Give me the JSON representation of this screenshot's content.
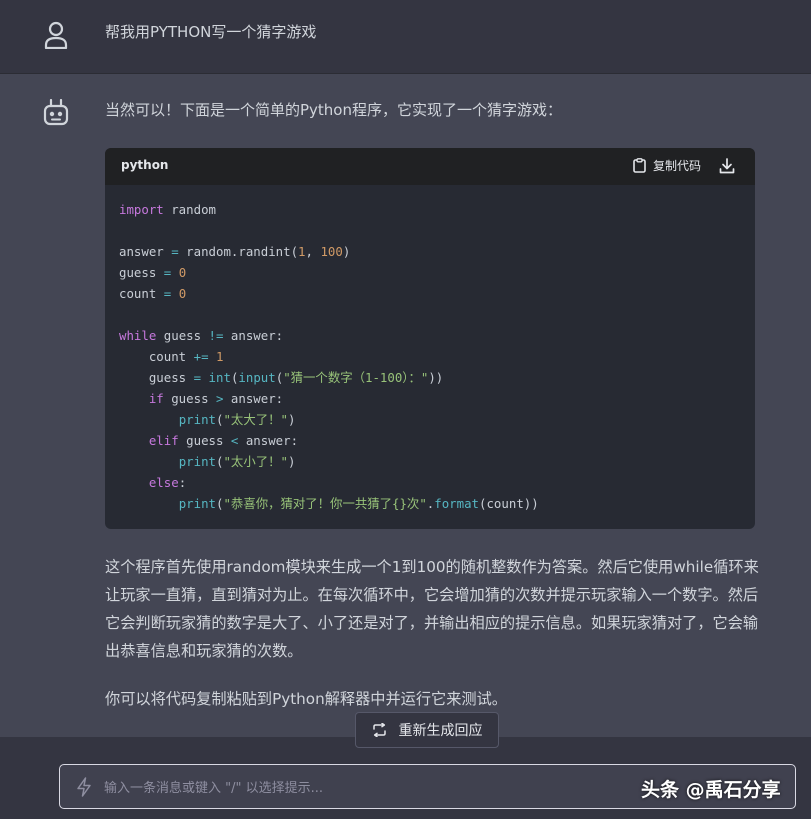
{
  "user_message": {
    "text": "帮我用PYTHON写一个猜字游戏"
  },
  "assistant": {
    "intro": "当然可以！下面是一个简单的Python程序，它实现了一个猜字游戏：",
    "code_block": {
      "language": "python",
      "copy_label": "复制代码",
      "lines": [
        "import random",
        "",
        "answer = random.randint(1, 100)",
        "guess = 0",
        "count = 0",
        "",
        "while guess != answer:",
        "    count += 1",
        "    guess = int(input(\"猜一个数字（1-100）：\"))",
        "    if guess > answer:",
        "        print(\"太大了！\")",
        "    elif guess < answer:",
        "        print(\"太小了！\")",
        "    else:",
        "        print(\"恭喜你，猜对了！你一共猜了{}次\".format(count))"
      ]
    },
    "paragraph_1": "这个程序首先使用random模块来生成一个1到100的随机整数作为答案。然后它使用while循环来让玩家一直猜，直到猜对为止。在每次循环中，它会增加猜的次数并提示玩家输入一个数字。然后它会判断玩家猜的数字是大了、小了还是对了，并输出相应的提示信息。如果玩家猜对了，它会输出恭喜信息和玩家猜的次数。",
    "paragraph_2": "你可以将代码复制粘贴到Python解释器中并运行它来测试。"
  },
  "regenerate_label": "重新生成回应",
  "input": {
    "placeholder": "输入一条消息或键入 \"/\" 以选择提示...",
    "value": ""
  },
  "watermark": "头条 @禹石分享",
  "icons": {
    "user": "user-icon",
    "bot": "robot-icon",
    "copy": "clipboard-icon",
    "download": "download-icon",
    "regenerate": "refresh-icon",
    "prompt": "lightning-icon"
  },
  "colors": {
    "user_bg": "#343541",
    "assistant_bg": "#444654",
    "code_bg": "#272a33",
    "code_header_bg": "#202123"
  }
}
